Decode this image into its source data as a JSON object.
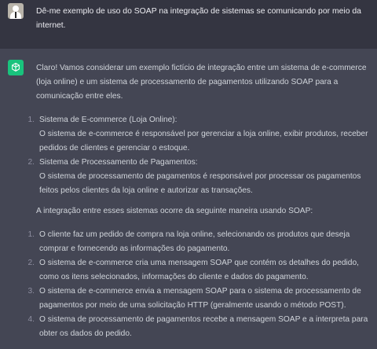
{
  "user": {
    "avatar_icon": "user-avatar-icon",
    "message": "Dê-me exemplo de uso do SOAP na integração de sistemas se comunicando por meio da internet."
  },
  "assistant": {
    "avatar_icon": "openai-logo-icon",
    "accent_color": "#19c37d",
    "intro": "Claro! Vamos considerar um exemplo fictício de integração entre um sistema de e-commerce (loja online) e um sistema de processamento de pagamentos utilizando SOAP para a comunicação entre eles.",
    "systems": [
      {
        "num": "1.",
        "title": "Sistema de E-commerce (Loja Online):",
        "desc": "O sistema de e-commerce é responsável por gerenciar a loja online, exibir produtos, receber pedidos de clientes e gerenciar o estoque."
      },
      {
        "num": "2.",
        "title": "Sistema de Processamento de Pagamentos:",
        "desc": "O sistema de processamento de pagamentos é responsável por processar os pagamentos feitos pelos clientes da loja online e autorizar as transações."
      }
    ],
    "middle": "A integração entre esses sistemas ocorre da seguinte maneira usando SOAP:",
    "steps": [
      {
        "num": "1.",
        "text": "O cliente faz um pedido de compra na loja online, selecionando os produtos que deseja comprar e fornecendo as informações do pagamento."
      },
      {
        "num": "2.",
        "text": "O sistema de e-commerce cria uma mensagem SOAP que contém os detalhes do pedido, como os itens selecionados, informações do cliente e dados do pagamento."
      },
      {
        "num": "3.",
        "text": "O sistema de e-commerce envia a mensagem SOAP para o sistema de processamento de pagamentos por meio de uma solicitação HTTP (geralmente usando o método POST)."
      },
      {
        "num": "4.",
        "text": "O sistema de processamento de pagamentos recebe a mensagem SOAP e a interpreta para obter os dados do pedido."
      }
    ]
  }
}
